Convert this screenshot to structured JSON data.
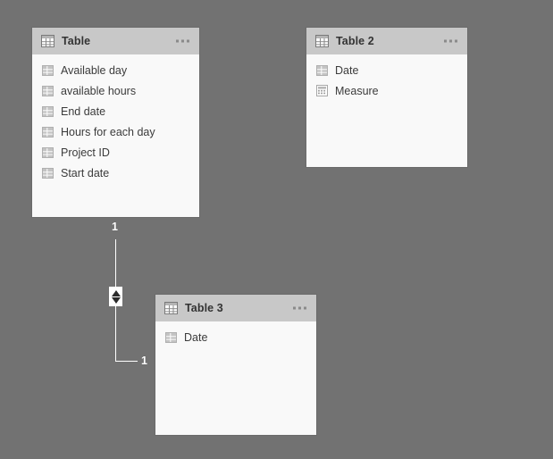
{
  "canvas": {
    "background_color": "#727272",
    "card_background": "#f9f9f9",
    "card_header_color": "#c8c8c8",
    "relationship_line_color": "#ffffff"
  },
  "tables": [
    {
      "id": "table-1",
      "title": "Table",
      "header_icon": "table-icon",
      "menu_icon": "more-options-icon",
      "fields": [
        {
          "label": "Available day",
          "icon": "column-field-icon"
        },
        {
          "label": "available hours",
          "icon": "column-field-icon"
        },
        {
          "label": "End date",
          "icon": "column-field-icon"
        },
        {
          "label": "Hours for each day",
          "icon": "column-field-icon"
        },
        {
          "label": "Project ID",
          "icon": "column-field-icon"
        },
        {
          "label": "Start date",
          "icon": "column-field-icon"
        }
      ]
    },
    {
      "id": "table-2",
      "title": "Table 2",
      "header_icon": "table-icon",
      "menu_icon": "more-options-icon",
      "fields": [
        {
          "label": "Date",
          "icon": "column-field-icon"
        },
        {
          "label": "Measure",
          "icon": "measure-calculator-icon"
        }
      ]
    },
    {
      "id": "table-3",
      "title": "Table 3",
      "header_icon": "table-icon",
      "menu_icon": "more-options-icon",
      "fields": [
        {
          "label": "Date",
          "icon": "column-field-icon"
        }
      ]
    }
  ],
  "relationship": {
    "from_cardinality": "1",
    "to_cardinality": "1",
    "cross_filter_direction": "both",
    "cross_filter_icon": "bidirectional-arrows-icon"
  }
}
